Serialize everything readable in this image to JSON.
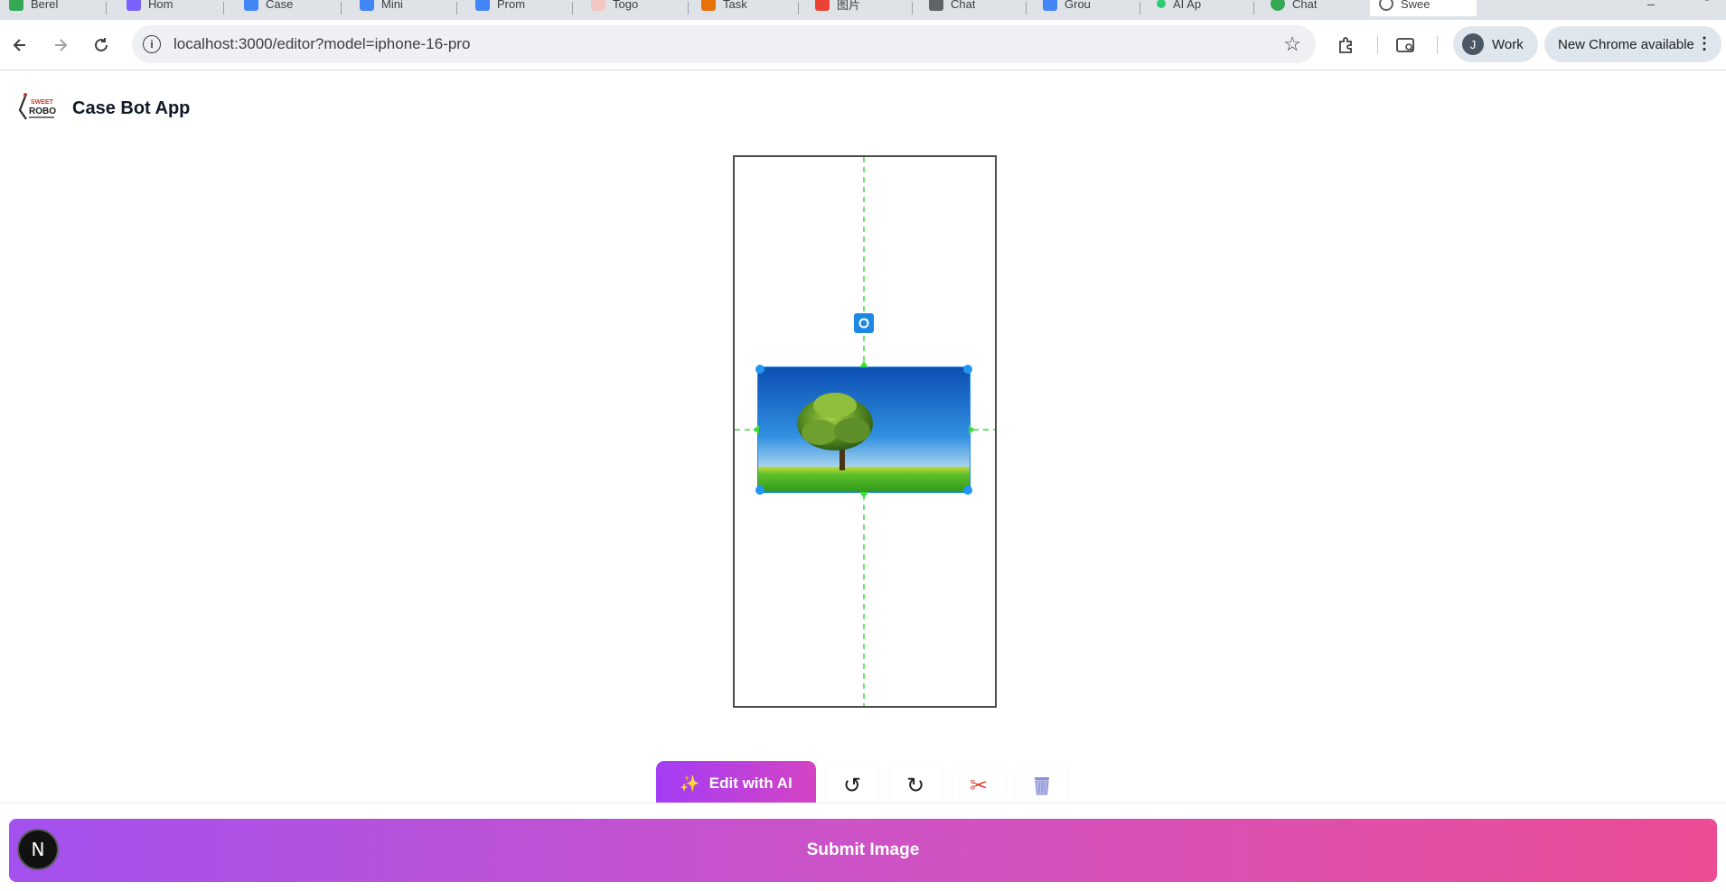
{
  "browser": {
    "tabs": [
      {
        "title": "Berel",
        "color": "#34a853"
      },
      {
        "title": "Hom",
        "color": "#7b61ff"
      },
      {
        "title": "Case",
        "color": "#4285f4"
      },
      {
        "title": "Mini",
        "color": "#4285f4"
      },
      {
        "title": "Prom",
        "color": "#4285f4"
      },
      {
        "title": "Togo",
        "color": "#f4c7c3"
      },
      {
        "title": "Task",
        "color": "#e8710a"
      },
      {
        "title": "图片",
        "color": "#ea4335"
      },
      {
        "title": "Chat",
        "color": "#5f6368"
      },
      {
        "title": "Grou",
        "color": "#4285f4"
      },
      {
        "title": "AI Ap",
        "color": "#2ecc71"
      },
      {
        "title": "Chat",
        "color": "#34a853"
      },
      {
        "title": "Swee",
        "color": "#5f6368"
      }
    ],
    "url": "localhost:3000/editor?model=iphone-16-pro",
    "profile_initial": "J",
    "profile_label": "Work",
    "update_label": "New Chrome available"
  },
  "app": {
    "title": "Case Bot App",
    "logo_text": "SWEET ROBO"
  },
  "editor": {
    "model": "iphone-16-pro",
    "image_subject": "tree-landscape"
  },
  "toolbar": {
    "ai_label": "Edit with AI",
    "undo_icon": "↺",
    "redo_icon": "↻",
    "cut_icon": "✂",
    "delete_icon": "trash-icon"
  },
  "footer": {
    "submit_label": "Submit Image",
    "badge_letter": "N"
  },
  "colors": {
    "accent_purple": "#a351ef",
    "accent_pink": "#ec4c93",
    "selection_blue": "#1e88e5",
    "guide_green": "#3ddc3d"
  }
}
